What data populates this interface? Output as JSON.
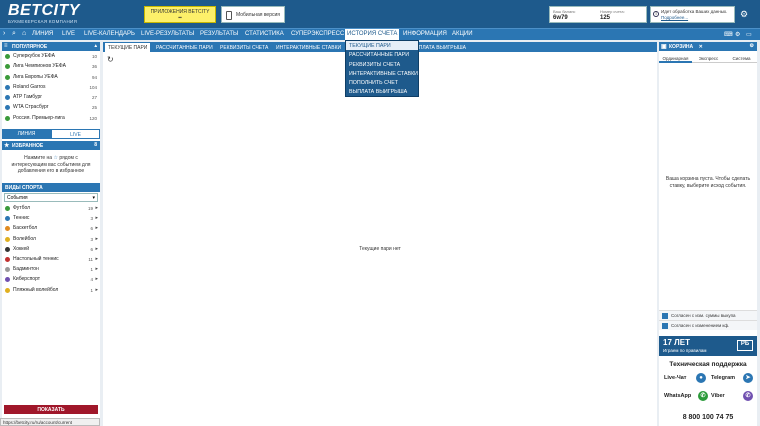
{
  "brand": {
    "name": "BETCITY",
    "tagline": "БУКМЕКЕРСКАЯ КОМПАНИЯ"
  },
  "header": {
    "apps_label": "ПРИЛОЖЕНИЯ BETCITY",
    "mobile_label": "Мобильная версия",
    "balance_label": "Ваш баланс",
    "balance_value": "6w79",
    "account_label": "Номер счета:",
    "account_value": "125",
    "bet_status_line1": "Идет обработка Ваших данных.",
    "bet_status_link": "Подробнее..."
  },
  "nav": {
    "items": [
      "ЛИНИЯ",
      "LIVE",
      "LIVE-КАЛЕНДАРЬ",
      "LIVE-РЕЗУЛЬТАТЫ",
      "РЕЗУЛЬТАТЫ",
      "СТАТИСТИКА",
      "СУПЕРЭКСПРЕСС",
      "ИСТОРИЯ СЧЕТА",
      "ИНФОРМАЦИЯ",
      "АКЦИИ"
    ],
    "active_index": 7
  },
  "dropdown": {
    "items": [
      "ТЕКУЩИЕ ПАРИ",
      "РАССЧИТАННЫЕ ПАРИ",
      "РЕКВИЗИТЫ СЧЕТА",
      "ИНТЕРАКТИВНЫЕ СТАВКИ",
      "ПОПОЛНИТЬ СЧЕТ",
      "ВЫПЛАТА ВЫИГРЫША"
    ],
    "selected_index": 0
  },
  "popular": {
    "title": "ПОПУЛЯРНОЕ",
    "items": [
      {
        "name": "Суперкубок УЕФА",
        "count": "10",
        "color": "#3a9a3a"
      },
      {
        "name": "Лига Чемпионов УЕФА",
        "count": "36",
        "color": "#3a9a3a"
      },
      {
        "name": "Лига Европы УЕФА",
        "count": "94",
        "color": "#3a9a3a"
      },
      {
        "name": "Roland Garros",
        "count": "104",
        "color": "#2b76b3"
      },
      {
        "name": "ATP Гамбург",
        "count": "27",
        "color": "#2b76b3"
      },
      {
        "name": "WTA Страсбург",
        "count": "25",
        "color": "#2b76b3"
      },
      {
        "name": "Россия. Премьер-лига",
        "count": "120",
        "color": "#3a9a3a"
      }
    ]
  },
  "line_tabs": {
    "line": "ЛИНИЯ",
    "live": "LIVE"
  },
  "favorites": {
    "title": "ИЗБРАННОЕ",
    "count": "8",
    "text_before": "Нажмите на",
    "text_after": "рядом с интересующим вас событием для добавления его в избранное"
  },
  "sports": {
    "title": "ВИДЫ СПОРТА",
    "select_value": "События",
    "items": [
      {
        "name": "Футбол",
        "count": "19",
        "color": "#3a9a3a"
      },
      {
        "name": "Теннис",
        "count": "3",
        "color": "#2b76b3"
      },
      {
        "name": "Баскетбол",
        "count": "6",
        "color": "#e08a20"
      },
      {
        "name": "Волейбол",
        "count": "3",
        "color": "#e0b020"
      },
      {
        "name": "Хоккей",
        "count": "6",
        "color": "#333"
      },
      {
        "name": "Настольный теннис",
        "count": "11",
        "color": "#c03030"
      },
      {
        "name": "Бадминтон",
        "count": "1",
        "color": "#999"
      },
      {
        "name": "Киберспорт",
        "count": "4",
        "color": "#7050b0"
      },
      {
        "name": "Пляжный волейбол",
        "count": "1",
        "color": "#e0b020"
      }
    ]
  },
  "show_button": "ПОКАЗАТЬ",
  "main": {
    "tabs": [
      "ТЕКУЩИЕ ПАРИ",
      "РАССЧИТАННЫЕ ПАРИ",
      "РЕКВИЗИТЫ СЧЕТА",
      "ИНТЕРАКТИВНЫЕ СТАВКИ",
      "ВЫПЛАТА ВЫИГРЫША"
    ],
    "empty_text": "Текущие пари нет"
  },
  "cart": {
    "title": "КОРЗИНА",
    "tabs": [
      "Ординарная",
      "Экспресс",
      "Система"
    ],
    "empty_text": "Ваша корзина пуста. Чтобы сделать ставку, выберите исход события.",
    "agree1": "Согласен с изм. суммы выкупа",
    "agree2": "Согласен с изменением кф."
  },
  "age": {
    "title": "17 ЛЕТ",
    "subtitle": "Играем по правилам",
    "badge": "РБ"
  },
  "support": {
    "title": "Техническая поддержка",
    "livechat": "Live-Чат",
    "telegram": "Telegram",
    "whatsapp": "WhatsApp",
    "viber": "Viber",
    "phone": "8 800 100 74 75"
  },
  "status_url": "https://betcity.ru/ru/account/current"
}
